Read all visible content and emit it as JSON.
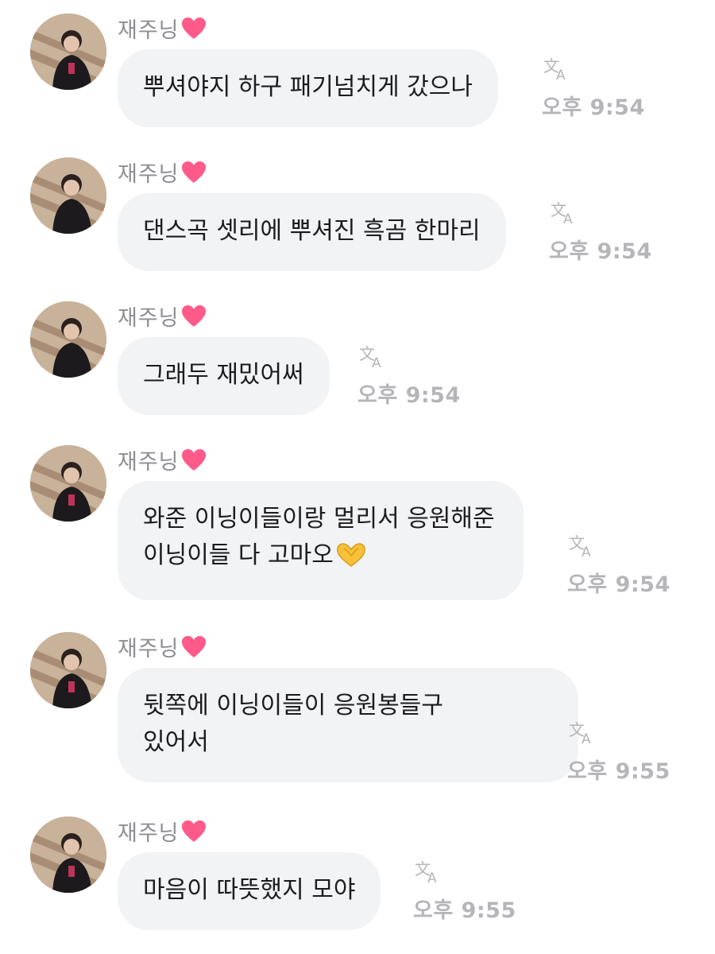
{
  "colors": {
    "bubble": "#f2f3f5",
    "name": "#8e8e93",
    "meta": "#b5b5ba",
    "heart": "#ff5a8a"
  },
  "messages": [
    {
      "sender": "재주닝",
      "text": "뿌셔야지 하구 패기넘치게 갔으나",
      "time": "오후 9:54"
    },
    {
      "sender": "재주닝",
      "text": "댄스곡 셋리에 뿌셔진 흑곰 한마리",
      "time": "오후 9:54"
    },
    {
      "sender": "재주닝",
      "text": "그래두 재밌어써",
      "time": "오후 9:54"
    },
    {
      "sender": "재주닝",
      "text": "와준 이닝이들이랑 멀리서 응원해준\n이닝이들 다 고마오",
      "emoji": "heart-hands",
      "time": "오후 9:54"
    },
    {
      "sender": "재주닝",
      "text": "뒷쪽에 이닝이들이 응원봉들구\n있어서",
      "time": "오후 9:55"
    },
    {
      "sender": "재주닝",
      "text": "마음이 따뜻했지 모야",
      "time": "오후 9:55"
    }
  ]
}
